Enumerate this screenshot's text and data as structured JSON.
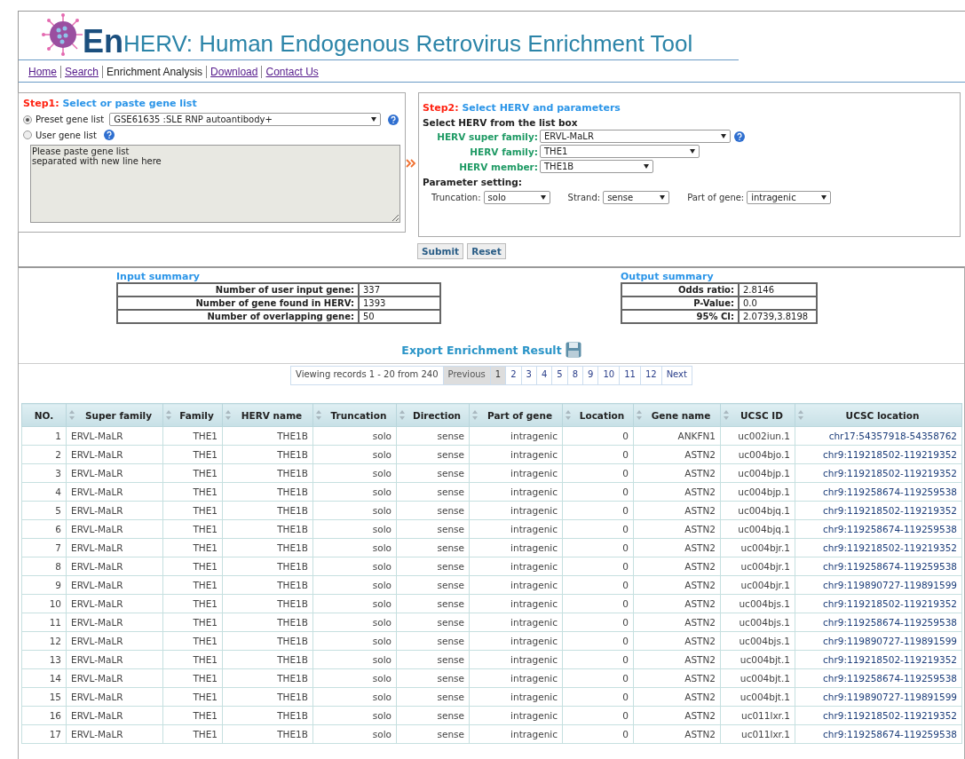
{
  "header": {
    "logo_prefix": "En",
    "title": "HERV: Human Endogenous Retrovirus Enrichment Tool"
  },
  "nav": [
    {
      "label": "Home",
      "selected": false
    },
    {
      "label": "Search",
      "selected": false
    },
    {
      "label": "Enrichment Analysis",
      "selected": true
    },
    {
      "label": "Download",
      "selected": false
    },
    {
      "label": "Contact Us",
      "selected": false
    }
  ],
  "step1": {
    "step": "Step1:",
    "title": "Select or paste gene list",
    "options": [
      {
        "label": "Preset gene list",
        "selected": true,
        "value": "GSE61635 :SLE RNP autoantibody+"
      },
      {
        "label": "User gene list",
        "selected": false
      }
    ],
    "textarea": {
      "placeholder": "Please paste gene list\nseparated with new line here"
    }
  },
  "step2": {
    "step": "Step2:",
    "title": "Select HERV and parameters",
    "subtitle": "Select HERV from the list box",
    "herv_fields": [
      {
        "label": "HERV super family:",
        "value": "ERVL-MaLR",
        "help": true
      },
      {
        "label": "HERV family:",
        "value": "THE1",
        "help": false
      },
      {
        "label": "HERV member:",
        "value": "THE1B",
        "help": false
      }
    ],
    "param_title": "Parameter setting:",
    "params": [
      {
        "label": "Truncation:",
        "value": "solo"
      },
      {
        "label": "Strand:",
        "value": "sense"
      },
      {
        "label": "Part of gene:",
        "value": "intragenic"
      }
    ]
  },
  "buttons": [
    "Submit",
    "Reset"
  ],
  "input_summary": {
    "title": "Input summary",
    "rows": [
      [
        "Number of user input gene:",
        "337"
      ],
      [
        "Number of gene found in HERV:",
        "1393"
      ],
      [
        "Number of overlapping gene:",
        "50"
      ]
    ]
  },
  "output_summary": {
    "title": "Output summary",
    "rows": [
      [
        "Odds ratio:",
        "2.8146"
      ],
      [
        "P-Value:",
        "0.0"
      ],
      [
        "95% CI:",
        "2.0739,3.8198"
      ]
    ]
  },
  "export": "Export Enrichment Result",
  "pagination": {
    "info": "Viewing records 1 - 20 from 240",
    "previous": {
      "label": "Previous",
      "disabled": true
    },
    "pages": [
      {
        "label": "1",
        "selected": true
      },
      {
        "label": "2",
        "selected": false
      },
      {
        "label": "3",
        "selected": false
      },
      {
        "label": "4",
        "selected": false
      },
      {
        "label": "5",
        "selected": false
      },
      {
        "label": "8",
        "selected": false
      },
      {
        "label": "9",
        "selected": false
      },
      {
        "label": "10",
        "selected": false
      },
      {
        "label": "11",
        "selected": false
      },
      {
        "label": "12",
        "selected": false
      }
    ],
    "next": {
      "label": "Next",
      "disabled": false
    }
  },
  "table": {
    "columns": [
      {
        "label": "NO.",
        "sortable": false
      },
      {
        "label": "Super family",
        "sortable": true
      },
      {
        "label": "Family",
        "sortable": true
      },
      {
        "label": "HERV name",
        "sortable": true
      },
      {
        "label": "Truncation",
        "sortable": true
      },
      {
        "label": "Direction",
        "sortable": true
      },
      {
        "label": "Part of gene",
        "sortable": true
      },
      {
        "label": "Location",
        "sortable": true
      },
      {
        "label": "Gene name",
        "sortable": true
      },
      {
        "label": "UCSC ID",
        "sortable": true
      },
      {
        "label": "UCSC location",
        "sortable": true
      }
    ],
    "rows": [
      [
        "1",
        "ERVL-MaLR",
        "THE1",
        "THE1B",
        "solo",
        "sense",
        "intragenic",
        "0",
        "ANKFN1",
        "uc002iun.1",
        "chr17:54357918-54358762"
      ],
      [
        "2",
        "ERVL-MaLR",
        "THE1",
        "THE1B",
        "solo",
        "sense",
        "intragenic",
        "0",
        "ASTN2",
        "uc004bjo.1",
        "chr9:119218502-119219352"
      ],
      [
        "3",
        "ERVL-MaLR",
        "THE1",
        "THE1B",
        "solo",
        "sense",
        "intragenic",
        "0",
        "ASTN2",
        "uc004bjp.1",
        "chr9:119218502-119219352"
      ],
      [
        "4",
        "ERVL-MaLR",
        "THE1",
        "THE1B",
        "solo",
        "sense",
        "intragenic",
        "0",
        "ASTN2",
        "uc004bjp.1",
        "chr9:119258674-119259538"
      ],
      [
        "5",
        "ERVL-MaLR",
        "THE1",
        "THE1B",
        "solo",
        "sense",
        "intragenic",
        "0",
        "ASTN2",
        "uc004bjq.1",
        "chr9:119218502-119219352"
      ],
      [
        "6",
        "ERVL-MaLR",
        "THE1",
        "THE1B",
        "solo",
        "sense",
        "intragenic",
        "0",
        "ASTN2",
        "uc004bjq.1",
        "chr9:119258674-119259538"
      ],
      [
        "7",
        "ERVL-MaLR",
        "THE1",
        "THE1B",
        "solo",
        "sense",
        "intragenic",
        "0",
        "ASTN2",
        "uc004bjr.1",
        "chr9:119218502-119219352"
      ],
      [
        "8",
        "ERVL-MaLR",
        "THE1",
        "THE1B",
        "solo",
        "sense",
        "intragenic",
        "0",
        "ASTN2",
        "uc004bjr.1",
        "chr9:119258674-119259538"
      ],
      [
        "9",
        "ERVL-MaLR",
        "THE1",
        "THE1B",
        "solo",
        "sense",
        "intragenic",
        "0",
        "ASTN2",
        "uc004bjr.1",
        "chr9:119890727-119891599"
      ],
      [
        "10",
        "ERVL-MaLR",
        "THE1",
        "THE1B",
        "solo",
        "sense",
        "intragenic",
        "0",
        "ASTN2",
        "uc004bjs.1",
        "chr9:119218502-119219352"
      ],
      [
        "11",
        "ERVL-MaLR",
        "THE1",
        "THE1B",
        "solo",
        "sense",
        "intragenic",
        "0",
        "ASTN2",
        "uc004bjs.1",
        "chr9:119258674-119259538"
      ],
      [
        "12",
        "ERVL-MaLR",
        "THE1",
        "THE1B",
        "solo",
        "sense",
        "intragenic",
        "0",
        "ASTN2",
        "uc004bjs.1",
        "chr9:119890727-119891599"
      ],
      [
        "13",
        "ERVL-MaLR",
        "THE1",
        "THE1B",
        "solo",
        "sense",
        "intragenic",
        "0",
        "ASTN2",
        "uc004bjt.1",
        "chr9:119218502-119219352"
      ],
      [
        "14",
        "ERVL-MaLR",
        "THE1",
        "THE1B",
        "solo",
        "sense",
        "intragenic",
        "0",
        "ASTN2",
        "uc004bjt.1",
        "chr9:119258674-119259538"
      ],
      [
        "15",
        "ERVL-MaLR",
        "THE1",
        "THE1B",
        "solo",
        "sense",
        "intragenic",
        "0",
        "ASTN2",
        "uc004bjt.1",
        "chr9:119890727-119891599"
      ],
      [
        "16",
        "ERVL-MaLR",
        "THE1",
        "THE1B",
        "solo",
        "sense",
        "intragenic",
        "0",
        "ASTN2",
        "uc011lxr.1",
        "chr9:119218502-119219352"
      ],
      [
        "17",
        "ERVL-MaLR",
        "THE1",
        "THE1B",
        "solo",
        "sense",
        "intragenic",
        "0",
        "ASTN2",
        "uc011lxr.1",
        "chr9:119258674-119259538"
      ]
    ]
  }
}
